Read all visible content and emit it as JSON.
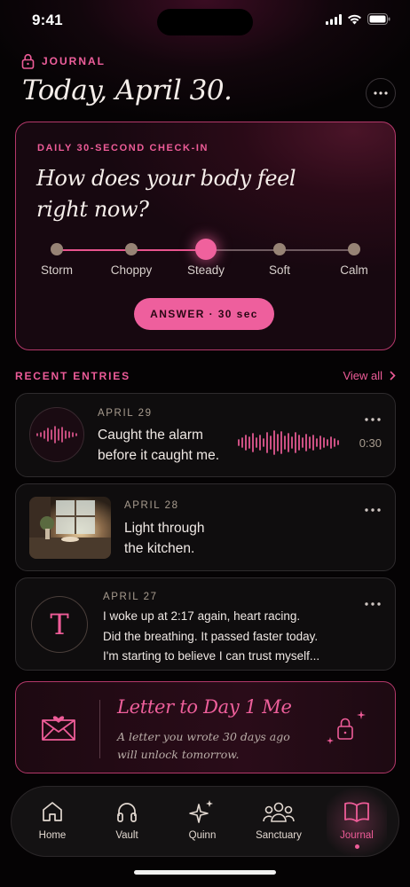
{
  "status": {
    "time": "9:41"
  },
  "header": {
    "section": "JOURNAL",
    "title": "Today, April 30."
  },
  "checkin": {
    "eyebrow": "DAILY 30-SECOND CHECK-IN",
    "question": "How does your body feel right now?",
    "options": [
      "Storm",
      "Choppy",
      "Steady",
      "Soft",
      "Calm"
    ],
    "selected": "Steady",
    "button": "ANSWER · 30 sec"
  },
  "recent": {
    "title": "RECENT ENTRIES",
    "view_all": "View all",
    "entries": [
      {
        "date": "APRIL 29",
        "text_line1": "Caught the alarm",
        "text_line2": "before it caught me.",
        "duration": "0:30"
      },
      {
        "date": "APRIL 28",
        "text_line1": "Light through",
        "text_line2": "the kitchen."
      },
      {
        "date": "APRIL 27",
        "initial": "T",
        "text_line1": "I woke up at 2:17 again, heart racing.",
        "text_line2": "Did the breathing. It passed faster today.",
        "text_line3": "I'm starting to believe I can trust myself..."
      }
    ]
  },
  "letter": {
    "title": "Letter to Day 1 Me",
    "sub_line1": "A letter you wrote 30 days ago",
    "sub_line2": "will unlock tomorrow."
  },
  "tabs": [
    {
      "label": "Home",
      "icon": "home-icon"
    },
    {
      "label": "Vault",
      "icon": "headphones-icon"
    },
    {
      "label": "Quinn",
      "icon": "sparkle-icon"
    },
    {
      "label": "Sanctuary",
      "icon": "people-icon"
    },
    {
      "label": "Journal",
      "icon": "book-icon",
      "active": true
    }
  ],
  "colors": {
    "accent": "#ee5c98",
    "background": "#050304"
  }
}
